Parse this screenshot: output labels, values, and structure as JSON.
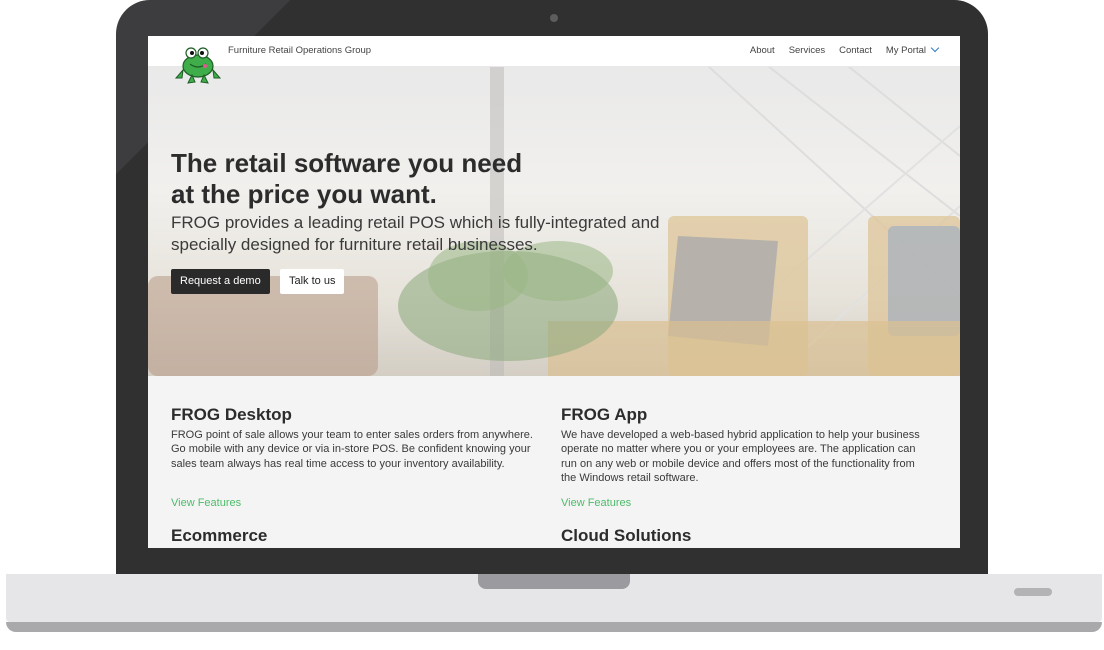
{
  "nav": {
    "brand": "Furniture Retail Operations Group",
    "links": [
      "About",
      "Services",
      "Contact",
      "My Portal"
    ],
    "logo_icon": "frog-logo-icon"
  },
  "hero": {
    "title_line1": "The retail software you need",
    "title_line2": "at the price you want.",
    "subtitle_line1": "FROG provides a leading retail POS which is fully-integrated and",
    "subtitle_line2": "specially designed for furniture retail businesses.",
    "primary_button": "Request a demo",
    "secondary_button": "Talk to us"
  },
  "features": [
    {
      "title": "FROG Desktop",
      "description": "FROG point of sale allows your team to enter sales orders from anywhere. Go mobile with any device or via in-store POS. Be confident knowing your sales team always has real time access to your inventory availability.",
      "link": "View Features"
    },
    {
      "title": "FROG App",
      "description": "We have developed a web-based hybrid application to help your business operate no matter where you or your employees are. The application can run on any web or mobile device and offers most of the functionality from the Windows retail software.",
      "link": "View Features"
    },
    {
      "title": "Ecommerce"
    },
    {
      "title": "Cloud Solutions"
    }
  ],
  "colors": {
    "accent_link": "#4dbb6a",
    "dropdown_chevron": "#2f7cc4",
    "primary_button_bg": "#2a2a2a",
    "laptop_frame": "#3d3d3f"
  }
}
